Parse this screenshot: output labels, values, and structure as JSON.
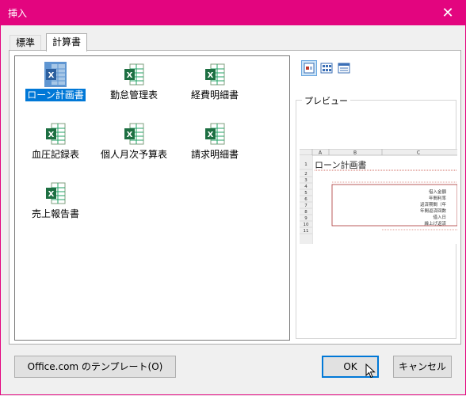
{
  "window": {
    "title": "挿入",
    "close_glyph": "✕",
    "frame_color": "#e3057f"
  },
  "tabs": [
    {
      "label": "標準",
      "active": false
    },
    {
      "label": "計算書",
      "active": true
    }
  ],
  "templates": [
    {
      "label": "ローン計画書",
      "selected": true
    },
    {
      "label": "勤怠管理表",
      "selected": false
    },
    {
      "label": "経費明細書",
      "selected": false
    },
    {
      "label": "血圧記録表",
      "selected": false
    },
    {
      "label": "個人月次予算表",
      "selected": false
    },
    {
      "label": "請求明細書",
      "selected": false
    },
    {
      "label": "売上報告書",
      "selected": false
    }
  ],
  "view_buttons": [
    {
      "icon": "large-icons-view-icon",
      "selected": true
    },
    {
      "icon": "list-view-icon",
      "selected": false
    },
    {
      "icon": "details-view-icon",
      "selected": false
    }
  ],
  "preview": {
    "label": "プレビュー",
    "columns": [
      "A",
      "B",
      "C"
    ],
    "rows": [
      "1",
      "2",
      "3",
      "4",
      "5",
      "6",
      "7",
      "8",
      "9",
      "10",
      "11"
    ],
    "sheet_title": "ローン計画書",
    "field_labels": [
      "借入金額",
      "年間利率",
      "返済期間（年",
      "年間返済回数",
      "借入日",
      "繰上げ返済"
    ]
  },
  "buttons": {
    "office_templates": "Office.com のテンプレート(O)",
    "ok": "OK",
    "cancel": "キャンセル"
  },
  "accent": "#0078d7"
}
